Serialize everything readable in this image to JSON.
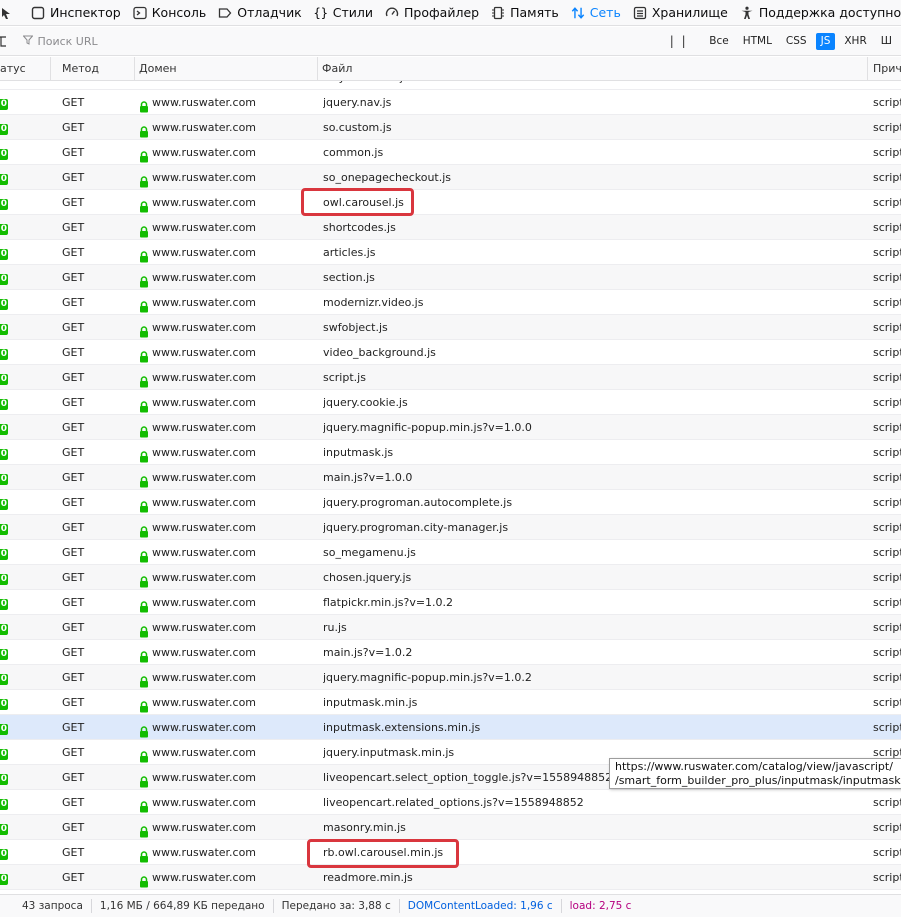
{
  "tabs": [
    {
      "name": "inspector",
      "label": "Инспектор",
      "icon": "inspector-icon"
    },
    {
      "name": "console",
      "label": "Консоль",
      "icon": "console-icon"
    },
    {
      "name": "debugger",
      "label": "Отладчик",
      "icon": "debugger-icon"
    },
    {
      "name": "styles",
      "label": "Стили",
      "icon": "braces-icon"
    },
    {
      "name": "profiler",
      "label": "Профайлер",
      "icon": "gauge-icon"
    },
    {
      "name": "memory",
      "label": "Память",
      "icon": "memory-chip-icon"
    },
    {
      "name": "network",
      "label": "Сеть",
      "icon": "network-arrows-icon",
      "active": true
    },
    {
      "name": "storage",
      "label": "Хранилище",
      "icon": "storage-icon"
    },
    {
      "name": "accessibility",
      "label": "Поддержка доступности",
      "icon": "accessibility-icon"
    }
  ],
  "toolbar": {
    "filter_placeholder": "Поиск URL",
    "pause_label": "| |",
    "chips": [
      {
        "label": "Все",
        "active": false
      },
      {
        "label": "HTML",
        "active": false
      },
      {
        "label": "CSS",
        "active": false
      },
      {
        "label": "JS",
        "active": true
      },
      {
        "label": "XHR",
        "active": false
      },
      {
        "label": "Ш",
        "active": false
      }
    ]
  },
  "columns": {
    "status": "атус",
    "method": "Метод",
    "domain": "Домен",
    "file": "Файл",
    "cause": "Приче"
  },
  "top_partial_row": {
    "file": "lazysizes.min.js"
  },
  "requests": [
    {
      "status": "0",
      "method": "GET",
      "domain": "www.ruswater.com",
      "file": "jquery.nav.js",
      "cause": "script"
    },
    {
      "status": "0",
      "method": "GET",
      "domain": "www.ruswater.com",
      "file": "so.custom.js",
      "cause": "script"
    },
    {
      "status": "0",
      "method": "GET",
      "domain": "www.ruswater.com",
      "file": "common.js",
      "cause": "script"
    },
    {
      "status": "0",
      "method": "GET",
      "domain": "www.ruswater.com",
      "file": "so_onepagecheckout.js",
      "cause": "script"
    },
    {
      "status": "0",
      "method": "GET",
      "domain": "www.ruswater.com",
      "file": "owl.carousel.js",
      "cause": "script"
    },
    {
      "status": "0",
      "method": "GET",
      "domain": "www.ruswater.com",
      "file": "shortcodes.js",
      "cause": "script"
    },
    {
      "status": "0",
      "method": "GET",
      "domain": "www.ruswater.com",
      "file": "articles.js",
      "cause": "script"
    },
    {
      "status": "0",
      "method": "GET",
      "domain": "www.ruswater.com",
      "file": "section.js",
      "cause": "script"
    },
    {
      "status": "0",
      "method": "GET",
      "domain": "www.ruswater.com",
      "file": "modernizr.video.js",
      "cause": "script"
    },
    {
      "status": "0",
      "method": "GET",
      "domain": "www.ruswater.com",
      "file": "swfobject.js",
      "cause": "script"
    },
    {
      "status": "0",
      "method": "GET",
      "domain": "www.ruswater.com",
      "file": "video_background.js",
      "cause": "script"
    },
    {
      "status": "0",
      "method": "GET",
      "domain": "www.ruswater.com",
      "file": "script.js",
      "cause": "script"
    },
    {
      "status": "0",
      "method": "GET",
      "domain": "www.ruswater.com",
      "file": "jquery.cookie.js",
      "cause": "script"
    },
    {
      "status": "0",
      "method": "GET",
      "domain": "www.ruswater.com",
      "file": "jquery.magnific-popup.min.js?v=1.0.0",
      "cause": "script"
    },
    {
      "status": "0",
      "method": "GET",
      "domain": "www.ruswater.com",
      "file": "inputmask.js",
      "cause": "script"
    },
    {
      "status": "0",
      "method": "GET",
      "domain": "www.ruswater.com",
      "file": "main.js?v=1.0.0",
      "cause": "script"
    },
    {
      "status": "0",
      "method": "GET",
      "domain": "www.ruswater.com",
      "file": "jquery.progroman.autocomplete.js",
      "cause": "script"
    },
    {
      "status": "0",
      "method": "GET",
      "domain": "www.ruswater.com",
      "file": "jquery.progroman.city-manager.js",
      "cause": "script"
    },
    {
      "status": "0",
      "method": "GET",
      "domain": "www.ruswater.com",
      "file": "so_megamenu.js",
      "cause": "script"
    },
    {
      "status": "0",
      "method": "GET",
      "domain": "www.ruswater.com",
      "file": "chosen.jquery.js",
      "cause": "script"
    },
    {
      "status": "0",
      "method": "GET",
      "domain": "www.ruswater.com",
      "file": "flatpickr.min.js?v=1.0.2",
      "cause": "script"
    },
    {
      "status": "0",
      "method": "GET",
      "domain": "www.ruswater.com",
      "file": "ru.js",
      "cause": "script"
    },
    {
      "status": "0",
      "method": "GET",
      "domain": "www.ruswater.com",
      "file": "main.js?v=1.0.2",
      "cause": "script"
    },
    {
      "status": "0",
      "method": "GET",
      "domain": "www.ruswater.com",
      "file": "jquery.magnific-popup.min.js?v=1.0.2",
      "cause": "script"
    },
    {
      "status": "0",
      "method": "GET",
      "domain": "www.ruswater.com",
      "file": "inputmask.min.js",
      "cause": "script"
    },
    {
      "status": "0",
      "method": "GET",
      "domain": "www.ruswater.com",
      "file": "inputmask.extensions.min.js",
      "cause": "script",
      "selected": true
    },
    {
      "status": "0",
      "method": "GET",
      "domain": "www.ruswater.com",
      "file": "jquery.inputmask.min.js",
      "cause": "script"
    },
    {
      "status": "0",
      "method": "GET",
      "domain": "www.ruswater.com",
      "file": "liveopencart.select_option_toggle.js?v=1558948852",
      "cause": "script"
    },
    {
      "status": "0",
      "method": "GET",
      "domain": "www.ruswater.com",
      "file": "liveopencart.related_options.js?v=1558948852",
      "cause": "script"
    },
    {
      "status": "0",
      "method": "GET",
      "domain": "www.ruswater.com",
      "file": "masonry.min.js",
      "cause": "script"
    },
    {
      "status": "0",
      "method": "GET",
      "domain": "www.ruswater.com",
      "file": "rb.owl.carousel.min.js",
      "cause": "script"
    },
    {
      "status": "0",
      "method": "GET",
      "domain": "www.ruswater.com",
      "file": "readmore.min.js",
      "cause": "script"
    }
  ],
  "tooltip": {
    "line1": "https://www.ruswater.com/catalog/view/javascript/",
    "line2": "/smart_form_builder_pro_plus/inputmask/inputmask."
  },
  "statusbar": {
    "requests": "43 запроса",
    "size": "1,16 МБ / 664,89 КБ передано",
    "finish": "Передано за: 3,88 с",
    "dom_loaded": "DOMContentLoaded: 1,96 с",
    "load": "load: 2,75 с"
  },
  "colors": {
    "accent": "#0a84ff",
    "status_ok": "#12bc00",
    "lock": "#12bc00",
    "highlight": "#d9363e",
    "selected_row": "#dde9fb"
  }
}
